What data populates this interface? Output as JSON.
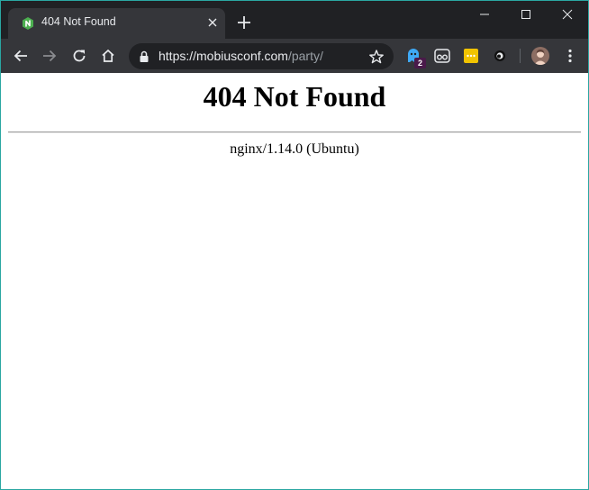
{
  "browser": {
    "tab": {
      "title": "404 Not Found",
      "favicon": "nginx-hexagon-icon"
    },
    "address_bar": {
      "host": "https://mobiusconf.com",
      "path": "/party/"
    },
    "extensions": [
      {
        "name": "ghost-extension-icon",
        "badge": "2"
      },
      {
        "name": "reader-extension-icon"
      },
      {
        "name": "notes-extension-icon"
      },
      {
        "name": "eye-extension-icon"
      }
    ],
    "colors": {
      "tab_strip": "#202124",
      "toolbar": "#35363a",
      "accent_window_border": "#2aa7a2",
      "favicon_green": "#4caf50"
    }
  },
  "page": {
    "heading": "404 Not Found",
    "server": "nginx/1.14.0 (Ubuntu)"
  }
}
